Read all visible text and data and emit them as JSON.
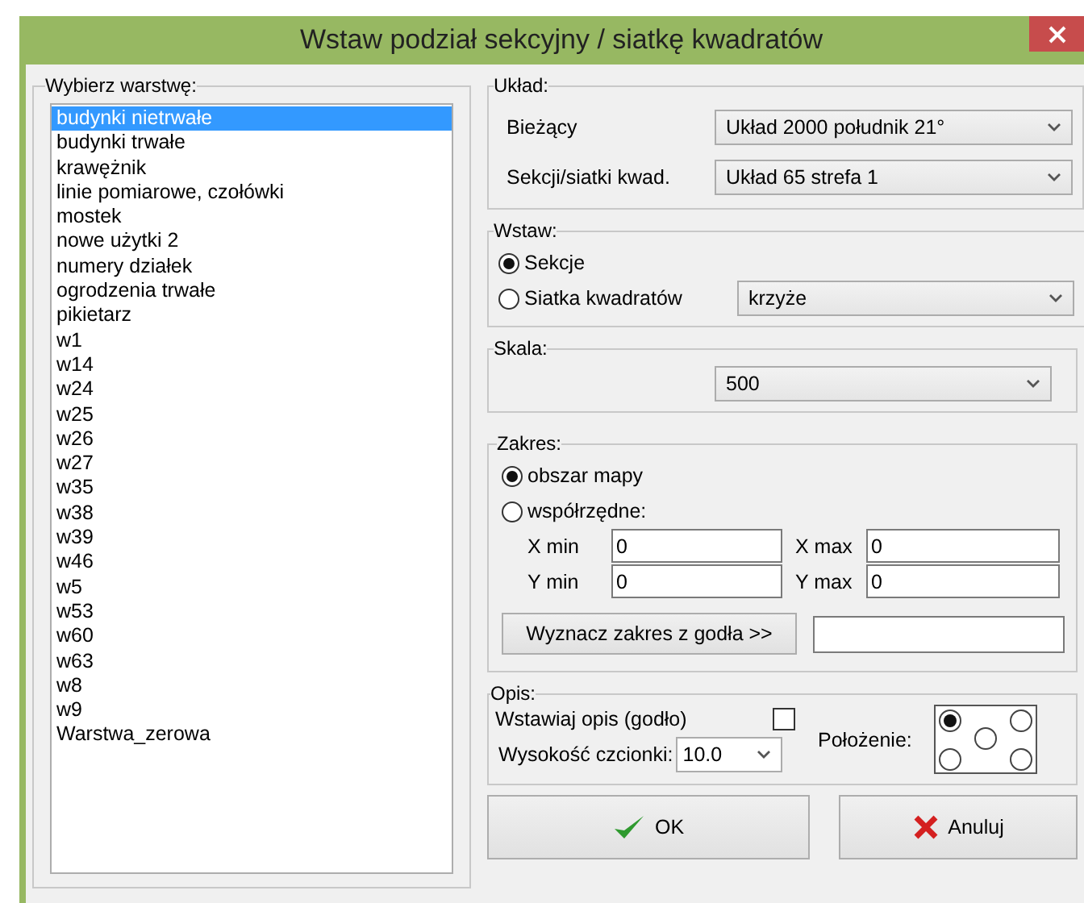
{
  "window": {
    "title": "Wstaw podział sekcyjny / siatkę kwadratów"
  },
  "layers": {
    "label": "Wybierz warstwę:",
    "items": [
      {
        "label": "budynki nietrwałe",
        "selected": true
      },
      {
        "label": "budynki trwałe",
        "selected": false
      },
      {
        "label": "krawężnik",
        "selected": false
      },
      {
        "label": "linie pomiarowe, czołówki",
        "selected": false
      },
      {
        "label": "mostek",
        "selected": false
      },
      {
        "label": "nowe użytki 2",
        "selected": false
      },
      {
        "label": "numery działek",
        "selected": false
      },
      {
        "label": "ogrodzenia trwałe",
        "selected": false
      },
      {
        "label": "pikietarz",
        "selected": false
      },
      {
        "label": "w1",
        "selected": false
      },
      {
        "label": "w14",
        "selected": false
      },
      {
        "label": "w24",
        "selected": false
      },
      {
        "label": "w25",
        "selected": false
      },
      {
        "label": "w26",
        "selected": false
      },
      {
        "label": "w27",
        "selected": false
      },
      {
        "label": "w35",
        "selected": false
      },
      {
        "label": "w38",
        "selected": false
      },
      {
        "label": "w39",
        "selected": false
      },
      {
        "label": "w46",
        "selected": false
      },
      {
        "label": "w5",
        "selected": false
      },
      {
        "label": "w53",
        "selected": false
      },
      {
        "label": "w60",
        "selected": false
      },
      {
        "label": "w63",
        "selected": false
      },
      {
        "label": "w8",
        "selected": false
      },
      {
        "label": "w9",
        "selected": false
      },
      {
        "label": "Warstwa_zerowa",
        "selected": false
      }
    ]
  },
  "uklad": {
    "label": "Układ:",
    "rows": [
      {
        "label": "Bieżący",
        "value": "Układ 2000 południk 21°"
      },
      {
        "label": "Sekcji/siatki kwad.",
        "value": "Układ 65 strefa 1"
      }
    ]
  },
  "wstaw": {
    "label": "Wstaw:",
    "options": [
      {
        "label": "Sekcje",
        "selected": true
      },
      {
        "label": "Siatka kwadratów",
        "selected": false,
        "combo": "krzyże"
      }
    ]
  },
  "skala": {
    "label": "Skala:",
    "value": "500"
  },
  "zakres": {
    "label": "Zakres:",
    "options": [
      {
        "label": "obszar mapy",
        "selected": true
      },
      {
        "label": "współrzędne:",
        "selected": false
      }
    ],
    "fields": [
      {
        "label": "X min",
        "value": "0"
      },
      {
        "label": "X max",
        "value": "0"
      },
      {
        "label": "Y min",
        "value": "0"
      },
      {
        "label": "Y max",
        "value": "0"
      }
    ],
    "button": "Wyznacz zakres z godła >>"
  },
  "opis": {
    "label": "Opis:",
    "checkbox": {
      "label": "Wstawiaj opis (godło)",
      "checked": false
    },
    "font_size": {
      "label": "Wysokość czcionki:",
      "value": "10.0"
    },
    "position_label": "Położenie:",
    "positions": [
      {
        "selected": true
      },
      {
        "selected": false
      },
      {
        "selected": false
      },
      {
        "selected": false
      },
      {
        "selected": false
      }
    ]
  },
  "buttons": [
    {
      "kind": "ok",
      "label": "OK"
    },
    {
      "kind": "cancel",
      "label": "Anuluj"
    }
  ]
}
